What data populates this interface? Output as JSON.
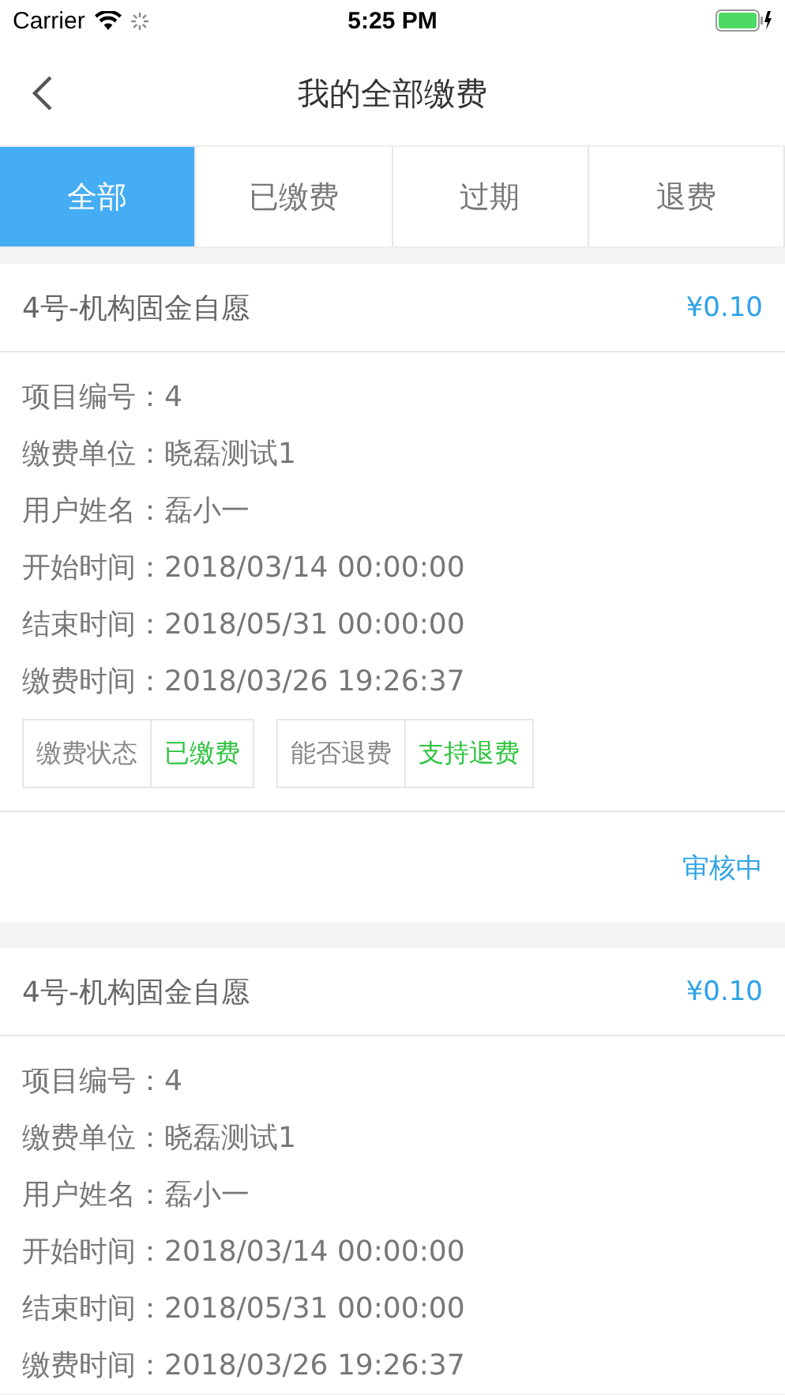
{
  "status_bar": {
    "carrier": "Carrier",
    "time": "5:25 PM"
  },
  "nav": {
    "title": "我的全部缴费"
  },
  "tabs": [
    {
      "label": "全部",
      "selected": true
    },
    {
      "label": "已缴费",
      "selected": false
    },
    {
      "label": "过期",
      "selected": false
    },
    {
      "label": "退费",
      "selected": false
    }
  ],
  "cards": [
    {
      "title": "4号-机构固金自愿",
      "amount": "¥0.10",
      "fields": [
        {
          "label": "项目编号：",
          "value": "4"
        },
        {
          "label": "缴费单位：",
          "value": "晓磊测试1"
        },
        {
          "label": "用户姓名：",
          "value": "磊小一"
        },
        {
          "label": "开始时间：",
          "value": "2018/03/14 00:00:00"
        },
        {
          "label": "结束时间：",
          "value": "2018/05/31 00:00:00"
        },
        {
          "label": "缴费时间：",
          "value": "2018/03/26 19:26:37"
        }
      ],
      "tags": [
        {
          "label": "缴费状态",
          "value": "已缴费"
        },
        {
          "label": "能否退费",
          "value": "支持退费"
        }
      ],
      "review_status": "审核中"
    },
    {
      "title": "4号-机构固金自愿",
      "amount": "¥0.10",
      "fields": [
        {
          "label": "项目编号：",
          "value": "4"
        },
        {
          "label": "缴费单位：",
          "value": "晓磊测试1"
        },
        {
          "label": "用户姓名：",
          "value": "磊小一"
        },
        {
          "label": "开始时间：",
          "value": "2018/03/14 00:00:00"
        },
        {
          "label": "结束时间：",
          "value": "2018/05/31 00:00:00"
        },
        {
          "label": "缴费时间：",
          "value": "2018/03/26 19:26:37"
        }
      ]
    }
  ]
}
